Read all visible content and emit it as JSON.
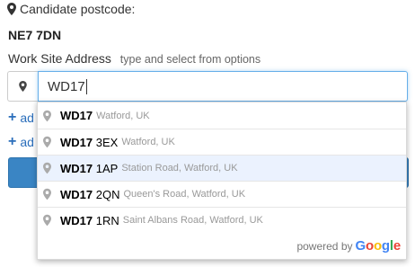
{
  "candidate": {
    "label": "Candidate postcode:",
    "value": "NE7 7DN"
  },
  "work_site": {
    "label": "Work Site Address",
    "hint": "type and select from options",
    "input_value": "WD17"
  },
  "links": [
    {
      "label": "ad"
    },
    {
      "label": "ad"
    }
  ],
  "suggestions": [
    {
      "match": "WD17",
      "rest": "",
      "secondary": "Watford, UK"
    },
    {
      "match": "WD17",
      "rest": "3EX",
      "secondary": "Watford, UK"
    },
    {
      "match": "WD17",
      "rest": "1AP",
      "secondary": "Station Road, Watford, UK"
    },
    {
      "match": "WD17",
      "rest": "2QN",
      "secondary": "Queen's Road, Watford, UK"
    },
    {
      "match": "WD17",
      "rest": "1RN",
      "secondary": "Saint Albans Road, Watford, UK"
    }
  ],
  "attribution": {
    "prefix": "powered by",
    "g1": "G",
    "g2": "o",
    "g3": "o",
    "g4": "g",
    "g5": "l",
    "g6": "e"
  },
  "colors": {
    "accent": "#3a85c4",
    "link": "#2a6ebb",
    "focus_border": "#66afe9",
    "selected_row": "#ebf2fe"
  }
}
